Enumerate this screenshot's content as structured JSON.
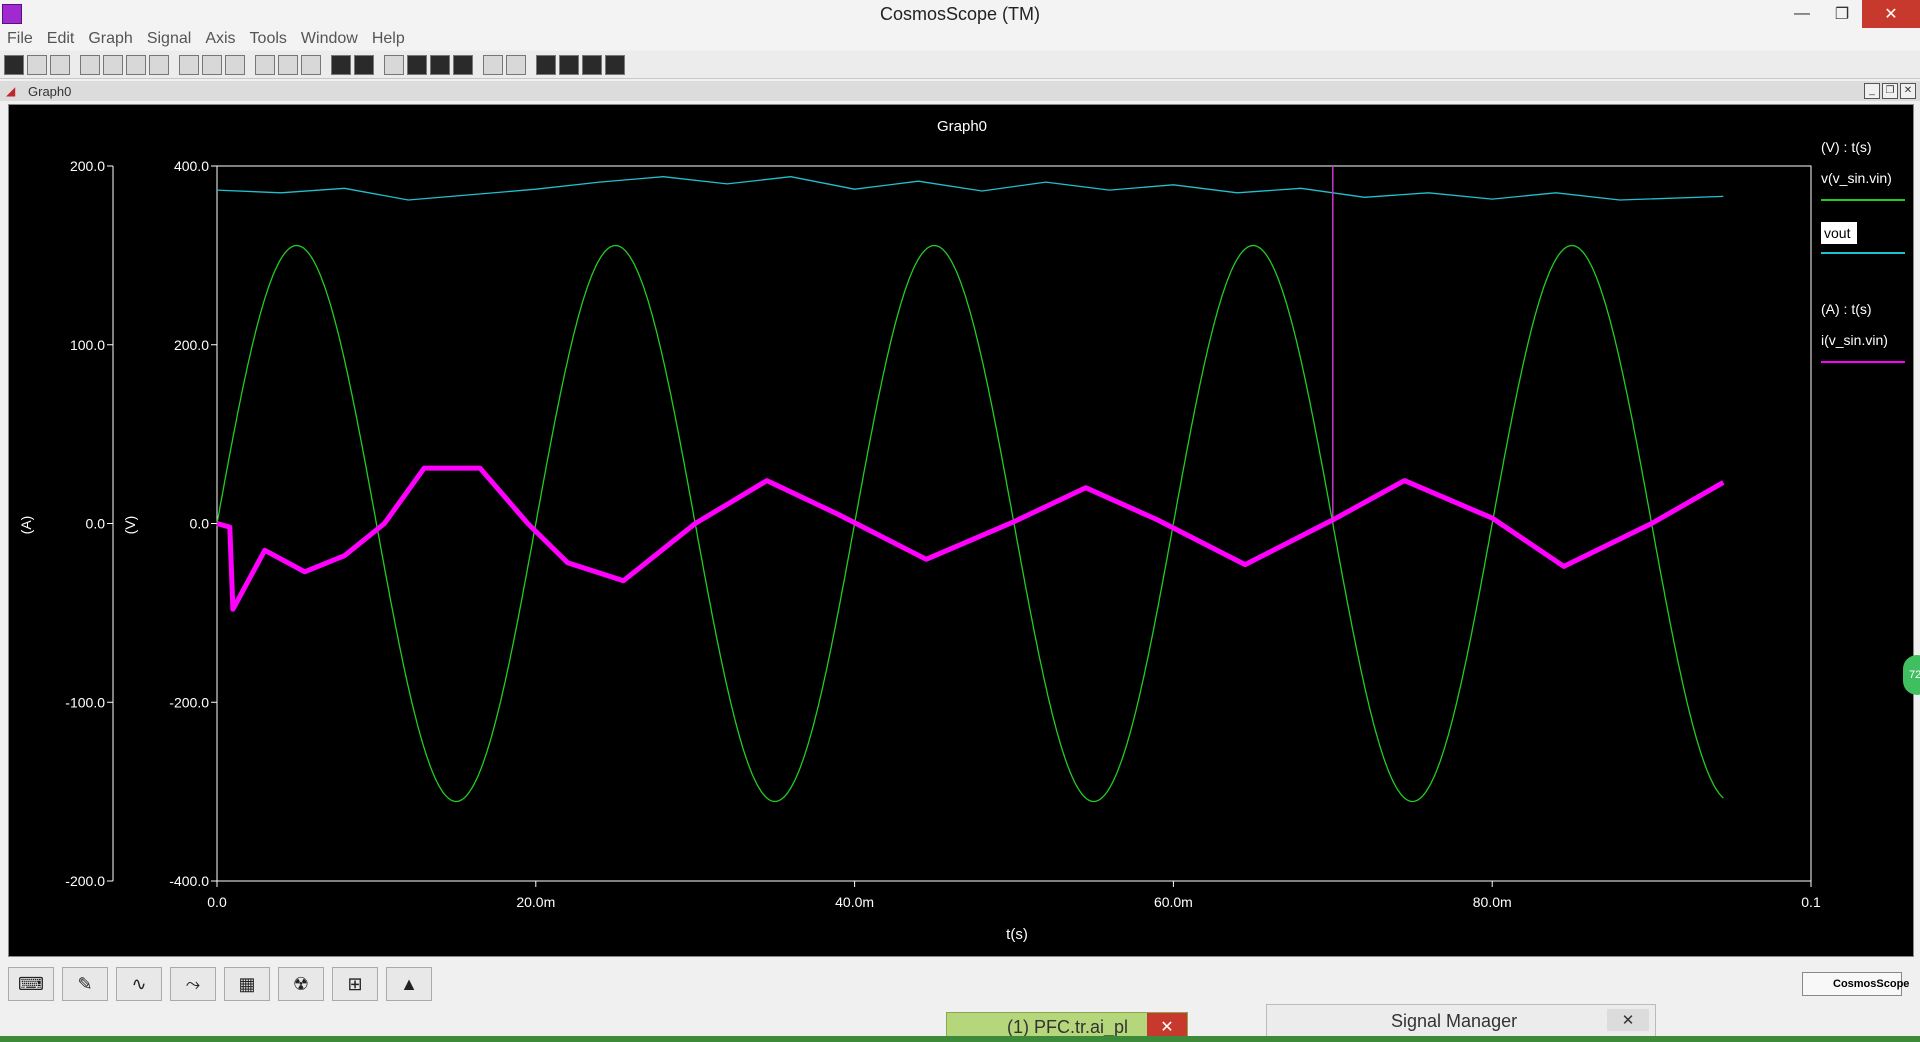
{
  "window": {
    "title": "CosmosScope (TM)",
    "minimize": "—",
    "restore": "❐",
    "close": "✕"
  },
  "menu": [
    "File",
    "Edit",
    "Graph",
    "Signal",
    "Axis",
    "Tools",
    "Window",
    "Help"
  ],
  "graph_window": {
    "title": "Graph0"
  },
  "plot": {
    "title": "Graph0",
    "xlabel": "t(s)",
    "left_axis_label": "(A)",
    "right_axis_label": "(V)",
    "legend": {
      "group_v": "(V) : t(s)",
      "v_signal": "v(v_sin.vin)",
      "vout": "vout",
      "group_a": "(A) : t(s)",
      "i_signal": "i(v_sin.vin)"
    },
    "colors": {
      "v": "#22cc22",
      "vout": "#22bfcf",
      "i": "#ff00ff",
      "cursor": "#cc33cc"
    }
  },
  "chart_data": {
    "type": "line",
    "title": "Graph0",
    "xlabel": "t(s)",
    "xlim": [
      0,
      0.1
    ],
    "x_ticks": [
      "0.0",
      "20.0m",
      "40.0m",
      "60.0m",
      "80.0m",
      "0.1"
    ],
    "y_axes": [
      {
        "label": "(A)",
        "ylim": [
          -200,
          200
        ],
        "ticks": [
          "200.0",
          "100.0",
          "0.0",
          "-100.0",
          "-200.0"
        ]
      },
      {
        "label": "(V)",
        "ylim": [
          -400,
          400
        ],
        "ticks": [
          "400.0",
          "200.0",
          "0.0",
          "-200.0",
          "-400.0"
        ]
      }
    ],
    "series": [
      {
        "name": "v(v_sin.vin)",
        "axis": "(V)",
        "x": [
          0,
          0.005,
          0.015,
          0.025,
          0.035,
          0.045,
          0.055,
          0.065,
          0.075,
          0.085,
          0.0945
        ],
        "y": [
          0,
          311,
          -311,
          311,
          -311,
          311,
          -311,
          311,
          -311,
          311,
          -311
        ]
      },
      {
        "name": "vout",
        "axis": "(V)",
        "x": [
          0,
          0.004,
          0.008,
          0.012,
          0.016,
          0.02,
          0.024,
          0.028,
          0.032,
          0.036,
          0.04,
          0.044,
          0.048,
          0.052,
          0.056,
          0.06,
          0.064,
          0.068,
          0.072,
          0.076,
          0.08,
          0.084,
          0.088,
          0.0945
        ],
        "y": [
          373,
          370,
          375,
          362,
          368,
          374,
          382,
          388,
          380,
          388,
          374,
          383,
          372,
          382,
          373,
          379,
          370,
          375,
          365,
          370,
          363,
          370,
          362,
          366
        ]
      },
      {
        "name": "i(v_sin.vin)",
        "axis": "(A)",
        "x": [
          0,
          0.0008,
          0.001,
          0.003,
          0.0055,
          0.008,
          0.0105,
          0.013,
          0.0165,
          0.0195,
          0.022,
          0.0255,
          0.03,
          0.0345,
          0.039,
          0.0445,
          0.05,
          0.0545,
          0.059,
          0.0645,
          0.07,
          0.0745,
          0.08,
          0.0845,
          0.09,
          0.0945
        ],
        "y": [
          0,
          -2,
          -48,
          -15,
          -27,
          -18,
          0,
          31,
          31,
          0,
          -22,
          -32,
          0,
          24,
          5,
          -20,
          1,
          20,
          2,
          -23,
          2,
          24,
          3,
          -24,
          0,
          23
        ]
      }
    ],
    "cursor_x": 0.07,
    "grid": false
  },
  "bottom_tools": [
    "keyboard-icon",
    "pencil-icon",
    "waveform-icon",
    "measure-icon",
    "calculator-icon",
    "radiation-icon",
    "schematic-icon",
    "matlab-icon"
  ],
  "logo_text": "CosmosScope",
  "taskbar": {
    "task1": "(1) PFC.tr.ai_pl",
    "signal_manager": "Signal Manager",
    "close": "✕"
  },
  "side_bubble": "72"
}
